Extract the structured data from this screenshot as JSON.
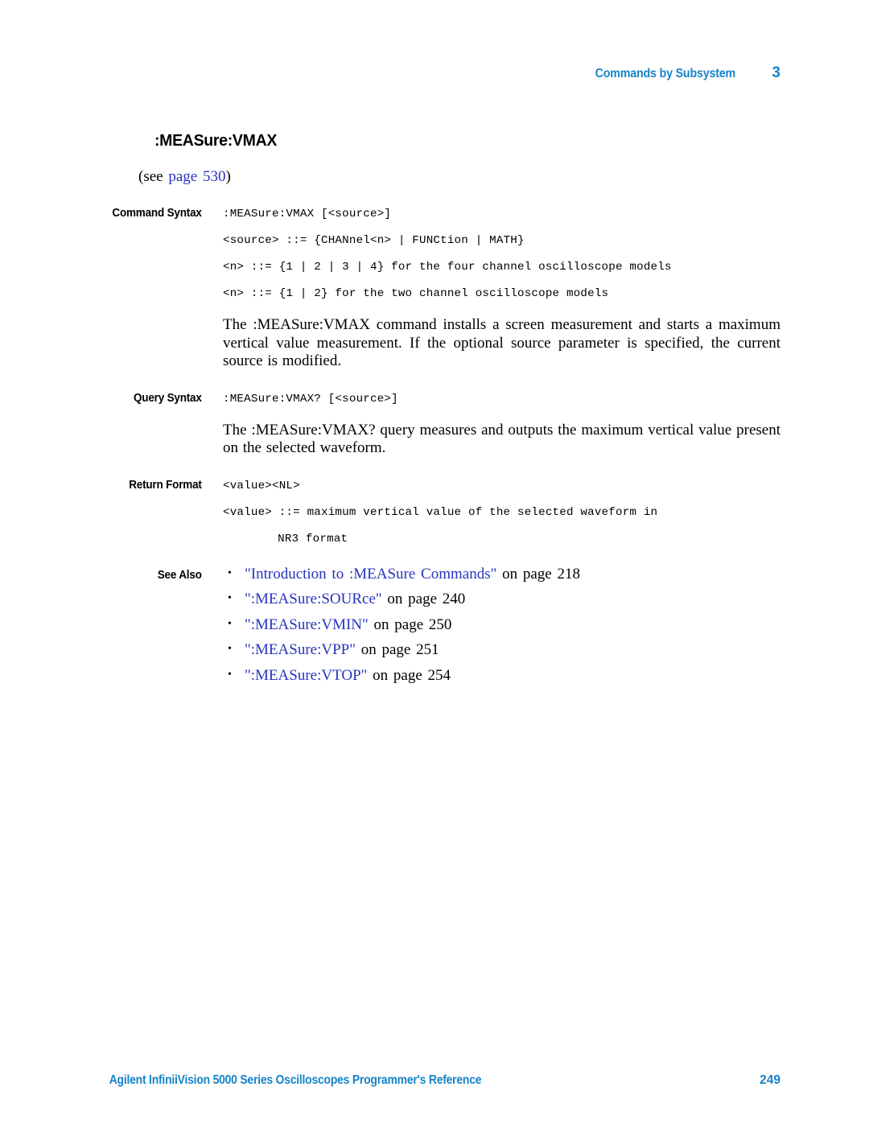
{
  "header": {
    "title": "Commands by Subsystem",
    "chapter": "3"
  },
  "command": {
    "title": ":MEASure:VMAX",
    "see_reference": {
      "prefix": "(see ",
      "link": "page 530",
      "suffix": ")"
    }
  },
  "sections": {
    "command_syntax": {
      "label": "Command Syntax",
      "lines": [
        ":MEASure:VMAX [<source>]",
        "<source> ::= {CHANnel<n> | FUNCtion | MATH}",
        "<n> ::= {1 | 2 | 3 | 4} for the four channel oscilloscope models",
        "<n> ::= {1 | 2} for the two channel oscilloscope models"
      ],
      "description": "The :MEASure:VMAX command installs a screen measurement and starts a maximum vertical value measurement. If the optional source parameter is specified, the current source is modified."
    },
    "query_syntax": {
      "label": "Query Syntax",
      "lines": [
        ":MEASure:VMAX? [<source>]"
      ],
      "description": "The :MEASure:VMAX? query measures and outputs the maximum vertical value present on the selected waveform."
    },
    "return_format": {
      "label": "Return Format",
      "lines": [
        "<value><NL>",
        "<value> ::= maximum vertical value of the selected waveform in"
      ],
      "indented_line": "NR3 format"
    },
    "see_also": {
      "label": "See Also",
      "items": [
        {
          "link": "\"Introduction to :MEASure Commands\"",
          "tail": " on page 218"
        },
        {
          "link": "\":MEASure:SOURce\"",
          "tail": " on page 240"
        },
        {
          "link": "\":MEASure:VMIN\"",
          "tail": " on page 250"
        },
        {
          "link": "\":MEASure:VPP\"",
          "tail": " on page 251"
        },
        {
          "link": "\":MEASure:VTOP\"",
          "tail": " on page 254"
        }
      ]
    }
  },
  "footer": {
    "text": "Agilent InfiniiVision 5000 Series Oscilloscopes Programmer's Reference",
    "page": "249"
  },
  "colors": {
    "header_blue": "#1683c8",
    "link_blue": "#2733bd",
    "body_black": "#000000"
  }
}
